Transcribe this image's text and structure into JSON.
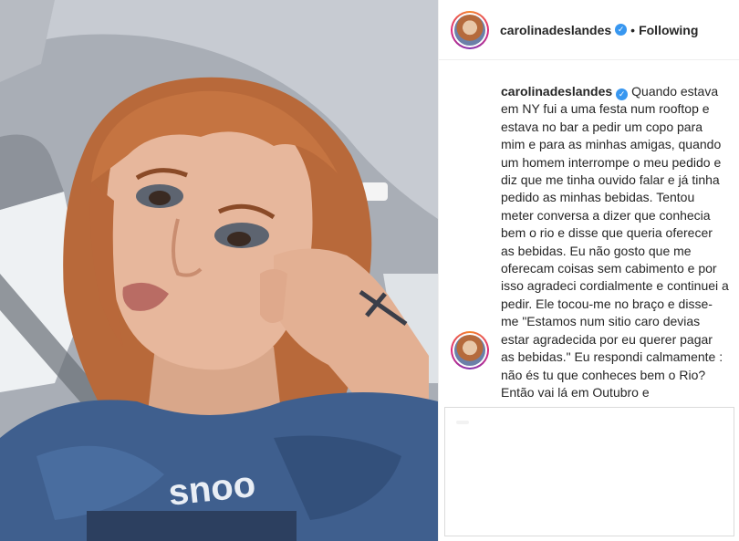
{
  "header": {
    "username": "carolinadeslandes",
    "verified_icon": "verified-badge-icon",
    "separator": "•",
    "follow_status": "Following"
  },
  "caption": {
    "username": "carolinadeslandes",
    "text": "Quando estava em NY fui a uma festa num rooftop e estava no bar a pedir um copo para mim e para as minhas amigas, quando um homem interrompe o meu pedido e diz que me tinha ouvido falar e já tinha pedido as minhas bebidas. Tentou meter conversa a dizer que conhecia bem o rio e disse que queria oferecer as bebidas. Eu não gosto que me oferecam coisas sem cabimento e por isso agradeci cordialmente e continuei a pedir. Ele tocou-me no braço e disse-me \"Estamos num sitio caro devias estar agradecida por eu querer pagar as bebidas.\" Eu respondi calmamente : não és tu que conheces bem o Rio? Então vai lá em Outubro e"
  },
  "photo": {
    "shirt_text": "snoo"
  },
  "colors": {
    "verified": "#3897f0",
    "text": "#262626",
    "border": "#dbdbdb"
  }
}
